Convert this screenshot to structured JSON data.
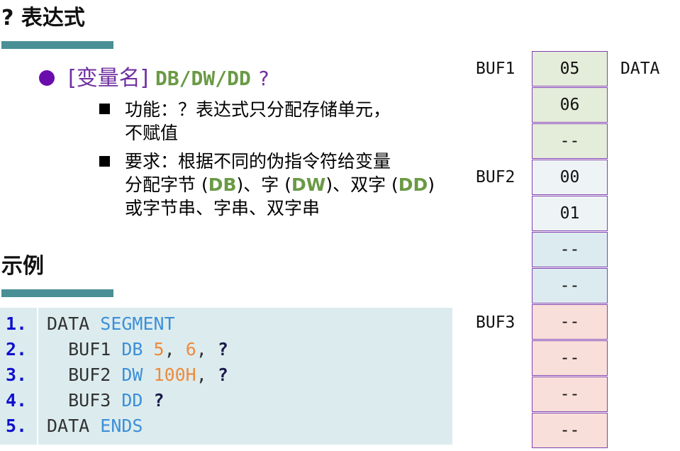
{
  "section1": {
    "title": "? 表达式"
  },
  "syntax": {
    "name": "[变量名]",
    "directives": "DB/DW/DD",
    "operand": "?"
  },
  "notes": {
    "func_line1": "功能：？表达式只分配存储单元，",
    "func_line2": "不赋值",
    "req_line1": "要求：根据不同的伪指令符给变量",
    "req_line2_a": "分配字节 (",
    "req_line2_db": "DB",
    "req_line2_b": ")、字 (",
    "req_line2_dw": "DW",
    "req_line2_c": ")、双字 (",
    "req_line2_dd": "DD",
    "req_line2_d": ")",
    "req_line3": "或字节串、字串、双字串"
  },
  "section2": {
    "title": "示例"
  },
  "code": [
    {
      "num": "1.",
      "parts": [
        {
          "t": "DATA ",
          "c": "black"
        },
        {
          "t": "SEGMENT",
          "c": "blue"
        }
      ]
    },
    {
      "num": "2.",
      "parts": [
        {
          "t": "  BUF1 ",
          "c": "black"
        },
        {
          "t": "DB ",
          "c": "blue"
        },
        {
          "t": "5",
          "c": "orange"
        },
        {
          "t": ", ",
          "c": "black"
        },
        {
          "t": "6",
          "c": "orange"
        },
        {
          "t": ", ",
          "c": "black"
        },
        {
          "t": "?",
          "c": "dark"
        }
      ]
    },
    {
      "num": "3.",
      "parts": [
        {
          "t": "  BUF2 ",
          "c": "black"
        },
        {
          "t": "DW ",
          "c": "blue"
        },
        {
          "t": "100H",
          "c": "orange"
        },
        {
          "t": ", ",
          "c": "black"
        },
        {
          "t": "?",
          "c": "dark"
        }
      ]
    },
    {
      "num": "4.",
      "parts": [
        {
          "t": "  BUF3 ",
          "c": "black"
        },
        {
          "t": "DD ",
          "c": "blue"
        },
        {
          "t": "?",
          "c": "dark"
        }
      ]
    },
    {
      "num": "5.",
      "parts": [
        {
          "t": "DATA ",
          "c": "black"
        },
        {
          "t": "ENDS",
          "c": "blue"
        }
      ]
    }
  ],
  "memory": {
    "labels": {
      "buf1": "BUF1",
      "buf2": "BUF2",
      "buf3": "BUF3",
      "data": "DATA"
    },
    "cells": [
      {
        "value": "05",
        "color": "#e4ecda"
      },
      {
        "value": "06",
        "color": "#e4ecda"
      },
      {
        "value": "--",
        "color": "#e4ecda"
      },
      {
        "value": "00",
        "color": "#eef4f5"
      },
      {
        "value": "01",
        "color": "#eef4f5"
      },
      {
        "value": "--",
        "color": "#dcebef"
      },
      {
        "value": "--",
        "color": "#dcebef"
      },
      {
        "value": "--",
        "color": "#f8dfd9"
      },
      {
        "value": "--",
        "color": "#f8dfd9"
      },
      {
        "value": "--",
        "color": "#f8dfd9"
      },
      {
        "value": "--",
        "color": "#f8dfd9"
      }
    ]
  }
}
